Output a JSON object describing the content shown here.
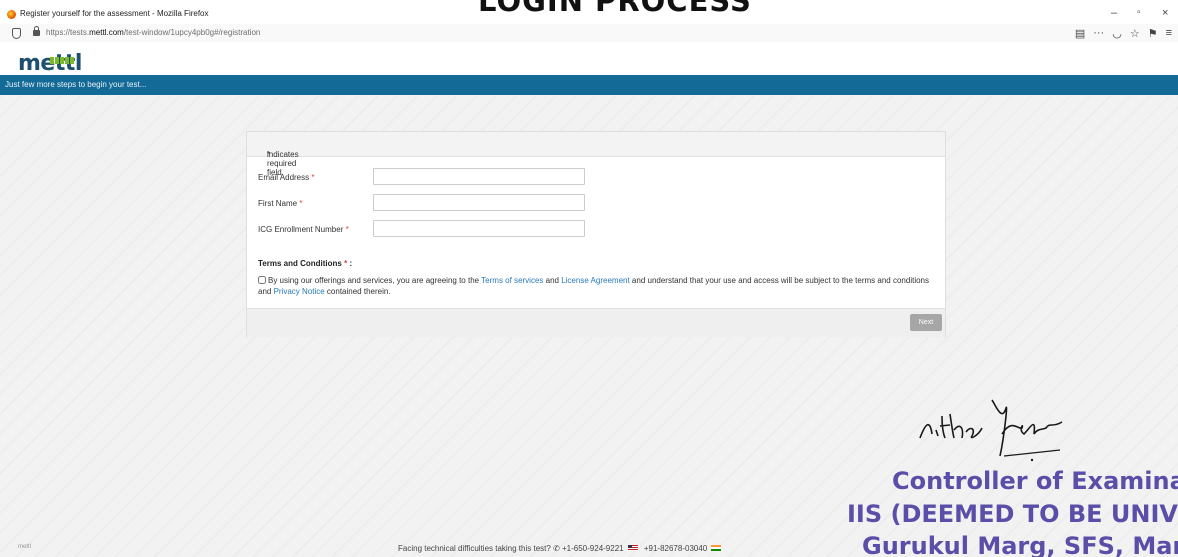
{
  "browser": {
    "window_title": "Register yourself for the assessment - Mozilla Firefox",
    "url_prefix": "https://tests.",
    "url_domain": "mettl.com",
    "url_path": "/test-window/1upcy4pb0g#/registration"
  },
  "overlay_heading": "LOGIN PROCESS",
  "site": {
    "logo_text": "mettl",
    "banner_text": "Just few more steps to begin your test..."
  },
  "form": {
    "required_note_star": "*",
    "required_note": " indicates required field",
    "fields": [
      {
        "label": "Email Address",
        "star": "*"
      },
      {
        "label": "First Name",
        "star": "*"
      },
      {
        "label": "ICG Enrollment Number",
        "star": "*"
      }
    ],
    "terms_heading": "Terms and Conditions",
    "terms_star": "*",
    "terms_colon": " :",
    "terms_part1": "By using our offerings and services, you are agreeing to the ",
    "terms_link1": "Terms of services",
    "terms_and": " and ",
    "terms_link2": "License Agreement",
    "terms_part2": " and understand that your use and access will be subject to the terms and conditions and ",
    "terms_link3": "Privacy Notice",
    "terms_part3": " contained therein.",
    "next_label": "Next"
  },
  "stamp": {
    "line1": "Controller of Examinatic",
    "line2": "IIS (DEEMED TO BE UNIVERS",
    "line3": "Gurukul Marg, SFS, Mansaro",
    "signature_text": "nithe Yadav"
  },
  "footer": {
    "powered_by": "mettl",
    "help_text": "Facing technical difficulties taking this test?",
    "phone_us": "+1-650-924-9221",
    "phone_in": "+91-82678-03040"
  },
  "colors": {
    "banner": "#136a96",
    "required": "#d9413d",
    "link": "#2a7ab8",
    "stamp": "#5b4ea8"
  }
}
